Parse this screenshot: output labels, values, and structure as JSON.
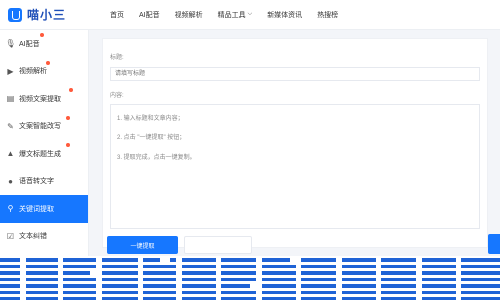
{
  "app": {
    "logo_text": "喵小三"
  },
  "nav": [
    {
      "label": "首页"
    },
    {
      "label": "AI配音"
    },
    {
      "label": "视频解析"
    },
    {
      "label": "精品工具"
    },
    {
      "label": "新媒体资讯"
    },
    {
      "label": "热搜榜"
    }
  ],
  "sidebar": {
    "items": [
      {
        "label": "AI配音",
        "icon": "mic-icon",
        "badge": true
      },
      {
        "label": "视频解析",
        "icon": "video-icon",
        "badge": true
      },
      {
        "label": "视频文案提取",
        "icon": "document-icon",
        "badge": true
      },
      {
        "label": "文案智能改写",
        "icon": "edit-icon",
        "badge": true
      },
      {
        "label": "爆文标题生成",
        "icon": "fire-icon",
        "badge": true
      },
      {
        "label": "语音转文字",
        "icon": "voice-icon",
        "badge": false
      },
      {
        "label": "关键词提取",
        "icon": "key-icon",
        "badge": false,
        "active": true
      },
      {
        "label": "文本纠错",
        "icon": "text-check-icon",
        "badge": false
      }
    ]
  },
  "form": {
    "title_label": "标题:",
    "title_placeholder": "请填写标题",
    "content_label": "内容:",
    "steps": [
      "1. 输入标题和文章内容；",
      "2. 点击 \"一键提取\" 按钮；",
      "3. 提取完成，点击一键复制。"
    ],
    "extract_button": "一键提取"
  },
  "colors": {
    "accent": "#1677ff",
    "badge": "#ff5a3c"
  }
}
